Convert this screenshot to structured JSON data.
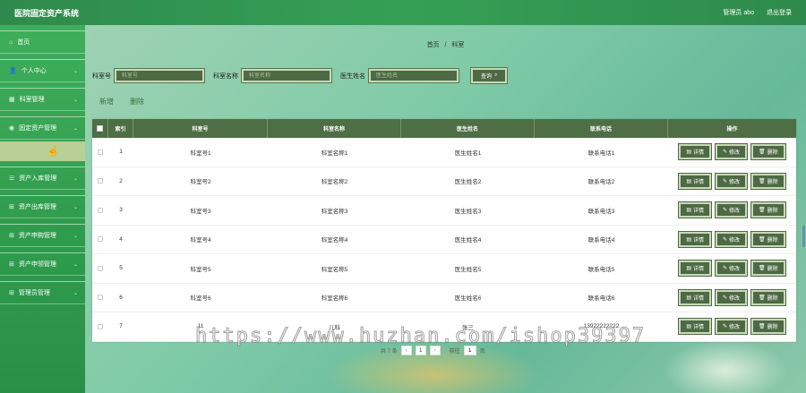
{
  "header": {
    "title": "医院固定资产系统",
    "user_label": "管理员 abo",
    "logout": "退出登录"
  },
  "sidebar": {
    "items": [
      {
        "label": "首页",
        "icon": "home-icon",
        "glyph": "⌂",
        "has_chevron": false
      },
      {
        "label": "个人中心",
        "icon": "user-icon",
        "glyph": "👤",
        "has_chevron": true
      },
      {
        "label": "科室管理",
        "icon": "building-icon",
        "glyph": "▦",
        "has_chevron": true
      },
      {
        "label": "固定资产管理",
        "icon": "asset-icon",
        "glyph": "◉",
        "has_chevron": true
      },
      {
        "label": "资产入库管理",
        "icon": "list-icon",
        "glyph": "☰",
        "has_chevron": true
      },
      {
        "label": "资产出库管理",
        "icon": "grid-icon",
        "glyph": "⊞",
        "has_chevron": true
      },
      {
        "label": "资产申购管理",
        "icon": "grid-icon",
        "glyph": "⊞",
        "has_chevron": true
      },
      {
        "label": "资产申领管理",
        "icon": "grid-icon",
        "glyph": "⊞",
        "has_chevron": true
      },
      {
        "label": "管理员管理",
        "icon": "grid-icon",
        "glyph": "⊞",
        "has_chevron": true
      }
    ]
  },
  "breadcrumb": {
    "home": "首页",
    "sep": "/",
    "current": "科室"
  },
  "search": {
    "fields": [
      {
        "label": "科室号",
        "placeholder": "科室号"
      },
      {
        "label": "科室名称",
        "placeholder": "科室名称"
      },
      {
        "label": "医生姓名",
        "placeholder": "医生姓名"
      }
    ],
    "button": "查询"
  },
  "actions": {
    "add": "新增",
    "delete": "删除"
  },
  "table": {
    "headers": [
      "索引",
      "科室号",
      "科室名称",
      "医生姓名",
      "联系电话",
      "操作"
    ],
    "rows": [
      [
        "1",
        "科室号1",
        "科室名称1",
        "医生姓名1",
        "联系电话1"
      ],
      [
        "2",
        "科室号2",
        "科室名称2",
        "医生姓名2",
        "联系电话2"
      ],
      [
        "3",
        "科室号3",
        "科室名称3",
        "医生姓名3",
        "联系电话3"
      ],
      [
        "4",
        "科室号4",
        "科室名称4",
        "医生姓名4",
        "联系电话4"
      ],
      [
        "5",
        "科室号5",
        "科室名称5",
        "医生姓名5",
        "联系电话5"
      ],
      [
        "6",
        "科室号6",
        "科室名称6",
        "医生姓名6",
        "联系电话6"
      ],
      [
        "7",
        "11",
        "儿科",
        "张三",
        "13922222222"
      ]
    ],
    "op_labels": {
      "detail": "详情",
      "edit": "修改",
      "delete": "删除"
    }
  },
  "pagination": {
    "total": "共 7 条",
    "page": "1",
    "goto_label": "前往",
    "goto_value": "1",
    "page_unit": "页"
  },
  "watermark": "https://www.huzhan.com/ishop39397",
  "colors": {
    "topbar": "#35a055",
    "sidebar": "#3fae5b",
    "table_header": "#4e6e45",
    "button": "#4d6a44"
  }
}
